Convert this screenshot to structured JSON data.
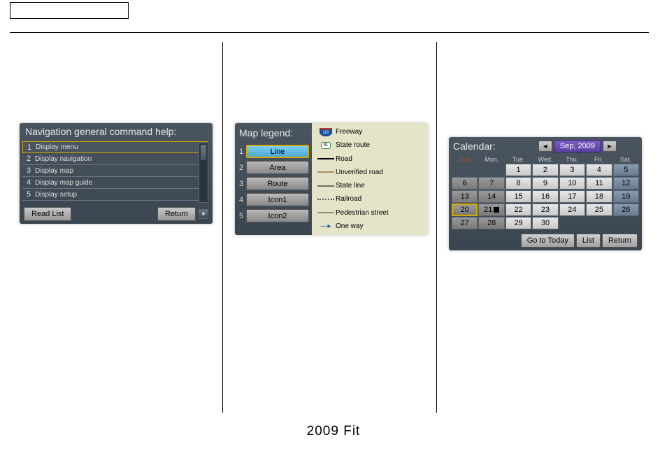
{
  "footer": "2009  Fit",
  "nav": {
    "title": "Navigation general command help:",
    "rows": [
      {
        "num": "1",
        "label": "Display menu"
      },
      {
        "num": "2",
        "label": "Display navigation"
      },
      {
        "num": "3",
        "label": "Display map"
      },
      {
        "num": "4",
        "label": "Display map guide"
      },
      {
        "num": "5",
        "label": "Display setup"
      }
    ],
    "read_list": "Read List",
    "return": "Return"
  },
  "legend": {
    "title": "Map legend:",
    "tabs": [
      {
        "num": "1",
        "label": "Line"
      },
      {
        "num": "2",
        "label": "Area"
      },
      {
        "num": "3",
        "label": "Route"
      },
      {
        "num": "4",
        "label": "Icon1"
      },
      {
        "num": "5",
        "label": "Icon2"
      }
    ],
    "items": [
      {
        "icon": "shield-110",
        "color": "",
        "label": "Freeway"
      },
      {
        "icon": "shield-91",
        "color": "",
        "label": "State route"
      },
      {
        "icon": "line",
        "color": "#000000",
        "label": "Road"
      },
      {
        "icon": "line",
        "color": "#a89060",
        "label": "Unverified road"
      },
      {
        "icon": "line",
        "color": "#707060",
        "label": "State line"
      },
      {
        "icon": "dotted",
        "color": "#606060",
        "label": "Railroad"
      },
      {
        "icon": "line",
        "color": "#909078",
        "label": "Pedestrian street"
      },
      {
        "icon": "arrow",
        "color": "#2050b0",
        "label": "One way"
      }
    ]
  },
  "calendar": {
    "title": "Calendar:",
    "month": "Sep, 2009",
    "day_heads": [
      "Sun.",
      "Mon.",
      "Tue.",
      "Wed.",
      "Thu.",
      "Fri.",
      "Sat."
    ],
    "weeks": [
      [
        "",
        "",
        "1",
        "2",
        "3",
        "4",
        "5"
      ],
      [
        "6",
        "7",
        "8",
        "9",
        "10",
        "11",
        "12"
      ],
      [
        "13",
        "14",
        "15",
        "16",
        "17",
        "18",
        "19"
      ],
      [
        "20",
        "21",
        "22",
        "23",
        "24",
        "25",
        "26"
      ],
      [
        "27",
        "28",
        "29",
        "30",
        "",
        "",
        ""
      ]
    ],
    "today_idx": [
      3,
      0
    ],
    "note_idx": [
      3,
      1
    ],
    "go_today": "Go to Today",
    "list": "List",
    "return": "Return"
  }
}
